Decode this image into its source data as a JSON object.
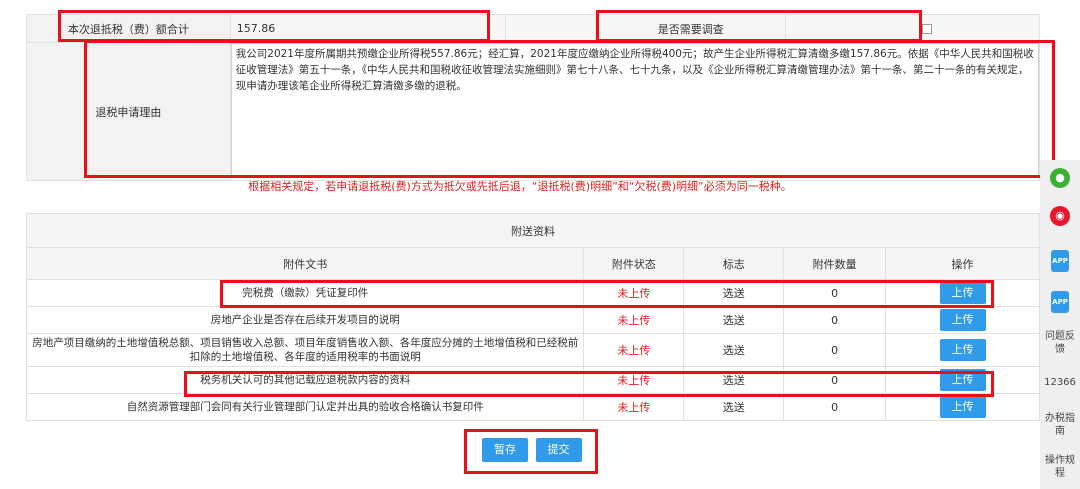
{
  "form": {
    "refund_total_label": "本次退抵税（费）额合计",
    "refund_total_value": "157.86",
    "need_investigation_label": "是否需要调查",
    "reason_label": "退税申请理由",
    "reason_text": "我公司2021年度所属期共预缴企业所得税557.86元；经汇算，2021年度应缴纳企业所得税400元；故产生企业所得税汇算清缴多缴157.86元。依据《中华人民共和国税收征收管理法》第五十一条，《中华人民共和国税收征收管理法实施细则》第七十八条、七十九条，以及《企业所得税汇算清缴管理办法》第十一条、第二十一条的有关规定，现申请办理该笔企业所得税汇算清缴多缴的退税。"
  },
  "notice": "根据相关规定，若申请退抵税(费)方式为抵欠或先抵后退，“退抵税(费)明细”和“欠税(费)明细”必须为同一税种。",
  "attachments": {
    "caption": "附送资料",
    "headers": [
      "附件文书",
      "附件状态",
      "标志",
      "附件数量",
      "操作"
    ],
    "rows": [
      {
        "doc": "完税费（缴款）凭证复印件",
        "status": "未上传",
        "flag": "选送",
        "count": "0",
        "action": "上传"
      },
      {
        "doc": "房地产企业是否存在后续开发项目的说明",
        "status": "未上传",
        "flag": "选送",
        "count": "0",
        "action": "上传"
      },
      {
        "doc": "房地产项目缴纳的土地增值税总额、项目销售收入总额、项目年度销售收入额、各年度应分摊的土地增值税和已经税前扣除的土地增值税、各年度的适用税率的书面说明",
        "status": "未上传",
        "flag": "选送",
        "count": "0",
        "action": "上传"
      },
      {
        "doc": "税务机关认可的其他记载应退税款内容的资料",
        "status": "未上传",
        "flag": "选送",
        "count": "0",
        "action": "上传"
      },
      {
        "doc": "自然资源管理部门会同有关行业管理部门认定并出具的验收合格确认书复印件",
        "status": "未上传",
        "flag": "选送",
        "count": "0",
        "action": "上传"
      }
    ]
  },
  "buttons": {
    "save": "暂存",
    "submit": "提交"
  },
  "sidebar": {
    "feedback": "问题反馈",
    "hotline": "12366",
    "guide": "办税指南",
    "rules": "操作规程",
    "app_label": "APP"
  },
  "colors": {
    "accent": "#2f9bea",
    "alert": "#e02020",
    "highlight": "#e8101a"
  }
}
